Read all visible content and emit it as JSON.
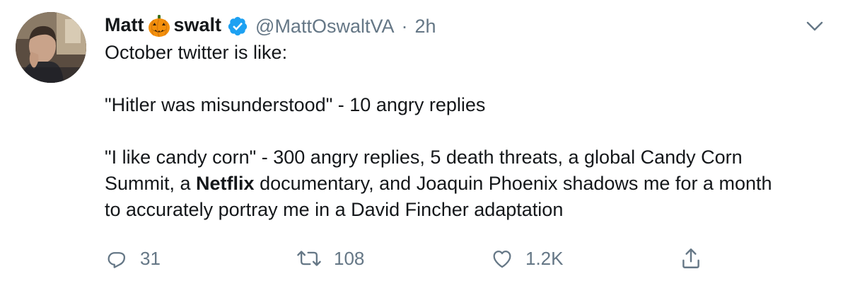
{
  "tweet": {
    "display_name_prefix": "Matt",
    "display_name_suffix": "swalt",
    "handle": "@MattOswaltVA",
    "separator": "·",
    "time": "2h",
    "lines": {
      "l1": "October twitter is like:",
      "l2": "\"Hitler was misunderstood\" - 10 angry replies",
      "l3": "\"I like candy corn\" - 300 angry replies, 5 death threats, a global Candy Corn",
      "l4a": "Summit, a ",
      "l4b": "Netflix",
      "l4c": " documentary, and Joaquin Phoenix shadows me for a month",
      "l5": "to accurately portray me in a David Fincher adaptation"
    },
    "icons": {
      "name_emoji": "jack-o-lantern-icon",
      "verified": "verified-badge-icon",
      "menu": "chevron-down-icon",
      "avatar": "profile-photo"
    }
  },
  "actions": {
    "reply_count": "31",
    "retweet_count": "108",
    "like_count": "1.2K"
  },
  "colors": {
    "text": "#14171a",
    "secondary": "#657786",
    "verified": "#1da1f2",
    "pumpkin": "#f4900c"
  }
}
